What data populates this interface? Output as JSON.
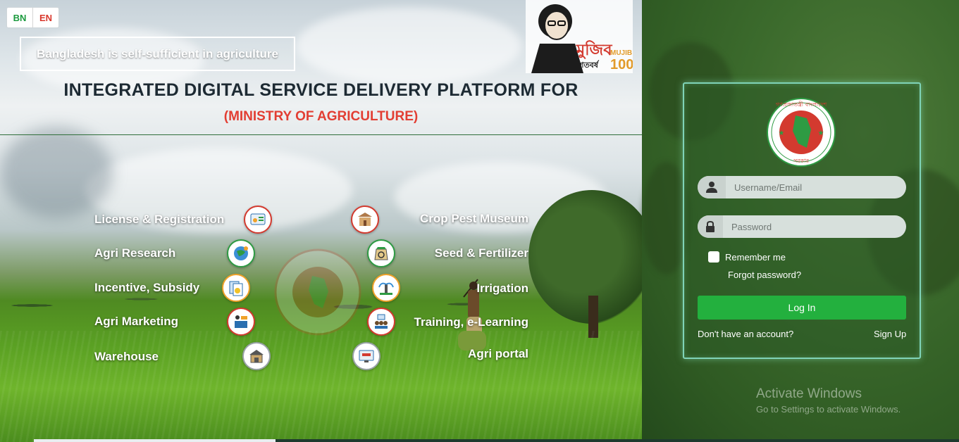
{
  "language": {
    "bn": "BN",
    "en": "EN"
  },
  "tagline": "Bangladesh is self-sufficient in agriculture",
  "title": "INTEGRATED DIGITAL SERVICE DELIVERY PLATFORM FOR",
  "subtitle": "(MINISTRY OF AGRICULTURE)",
  "mujib_logo": {
    "bn_text": "মুজিব",
    "bn_sub": "শতবর্ষ",
    "en_text": "MUJIB",
    "number": "100"
  },
  "services_left": [
    {
      "label": "License & Registration",
      "icon": "certificate-icon"
    },
    {
      "label": "Agri Research",
      "icon": "globe-research-icon"
    },
    {
      "label": "Incentive, Subsidy",
      "icon": "documents-icon"
    },
    {
      "label": "Agri Marketing",
      "icon": "marketing-icon"
    },
    {
      "label": "Warehouse",
      "icon": "warehouse-icon"
    }
  ],
  "services_right": [
    {
      "label": "Crop Pest Museum",
      "icon": "museum-icon"
    },
    {
      "label": "Seed & Fertilizer",
      "icon": "seed-sack-icon"
    },
    {
      "label": "Irrigation",
      "icon": "irrigation-icon"
    },
    {
      "label": "Training, e-Learning",
      "icon": "training-icon"
    },
    {
      "label": "Agri portal",
      "icon": "portal-icon"
    }
  ],
  "login": {
    "username_placeholder": "Username/Email",
    "password_placeholder": "Password",
    "remember_me": "Remember me",
    "forgot_password": "Forgot password?",
    "login_button": "Log In",
    "no_account": "Don't have an account?",
    "sign_up": "Sign Up"
  },
  "gov_emblem": {
    "top_text": "গণপ্রজাতন্ত্রী বাংলাদেশ",
    "bottom_text": "সরকার"
  },
  "windows_watermark": {
    "title": "Activate Windows",
    "subtitle": "Go to Settings to activate Windows."
  },
  "colors": {
    "accent_green": "#23b03e",
    "title_dark": "#1d2a33",
    "subtitle_red": "#e23e33",
    "card_border": "#7fd3b8"
  }
}
